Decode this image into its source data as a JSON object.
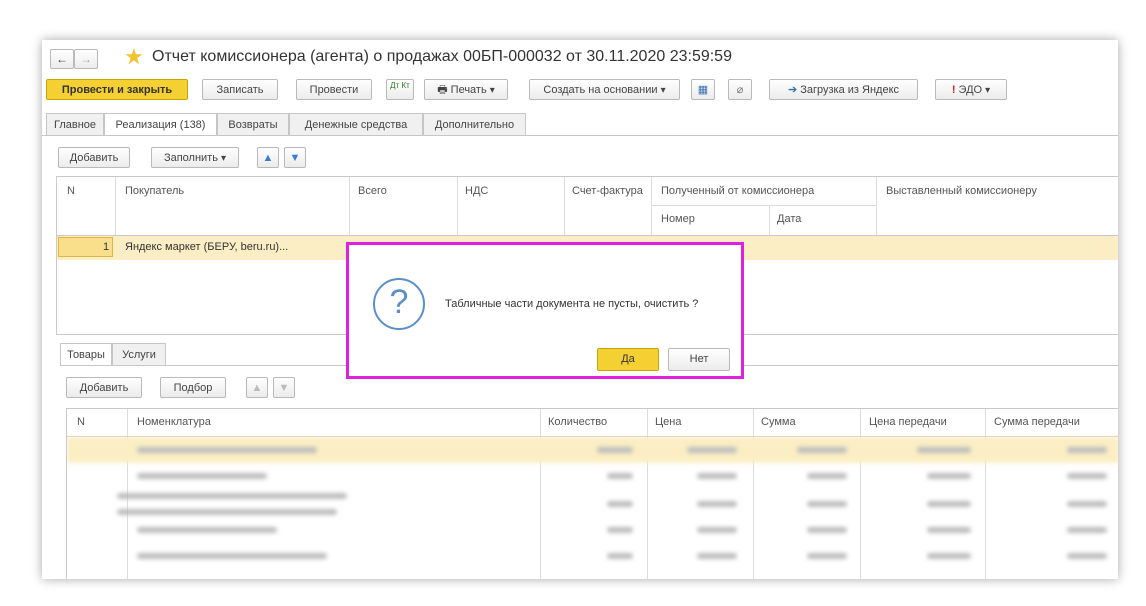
{
  "window": {
    "back_icon": "arrow-left",
    "forward_icon": "arrow-right",
    "favorite_icon": "star",
    "title": "Отчет комиссионера (агента) о продажах 00БП-000032 от 30.11.2020 23:59:59"
  },
  "toolbar": {
    "post_close": "Провести и закрыть",
    "save": "Записать",
    "post": "Провести",
    "dt_kt": "Дт Кт",
    "print": "Печать",
    "create_based": "Создать на основании",
    "yandex_load": "Загрузка из Яндекс",
    "edo": "ЭДО",
    "accent_color": "#f5d033"
  },
  "tabs": [
    {
      "label": "Главное"
    },
    {
      "label": "Реализация (138)"
    },
    {
      "label": "Возвраты"
    },
    {
      "label": "Денежные средства"
    },
    {
      "label": "Дополнительно"
    }
  ],
  "top_toolbar": {
    "add": "Добавить",
    "fill": "Заполнить"
  },
  "top_table": {
    "headers": {
      "n": "N",
      "buyer": "Покупатель",
      "total": "Всего",
      "vat": "НДС",
      "invoice": "Счет-фактура",
      "received": "Полученный от комиссионера",
      "number": "Номер",
      "date": "Дата",
      "issued": "Выставленный комиссионеру"
    },
    "row": {
      "n": "1",
      "buyer": "Яндекс маркет (БЕРУ, beru.ru)..."
    }
  },
  "sub_tabs": [
    {
      "label": "Товары"
    },
    {
      "label": "Услуги"
    }
  ],
  "bottom_toolbar": {
    "add": "Добавить",
    "pick": "Подбор"
  },
  "bottom_table": {
    "headers": {
      "n": "N",
      "nomenclature": "Номенклатура",
      "qty": "Количество",
      "price": "Цена",
      "sum": "Сумма",
      "transfer_price": "Цена передачи",
      "transfer_sum": "Сумма передачи"
    }
  },
  "dialog": {
    "icon": "question",
    "message": "Табличные части документа не пусты, очистить ?",
    "yes": "Да",
    "no": "Нет",
    "highlight_color": "#e020e0"
  }
}
